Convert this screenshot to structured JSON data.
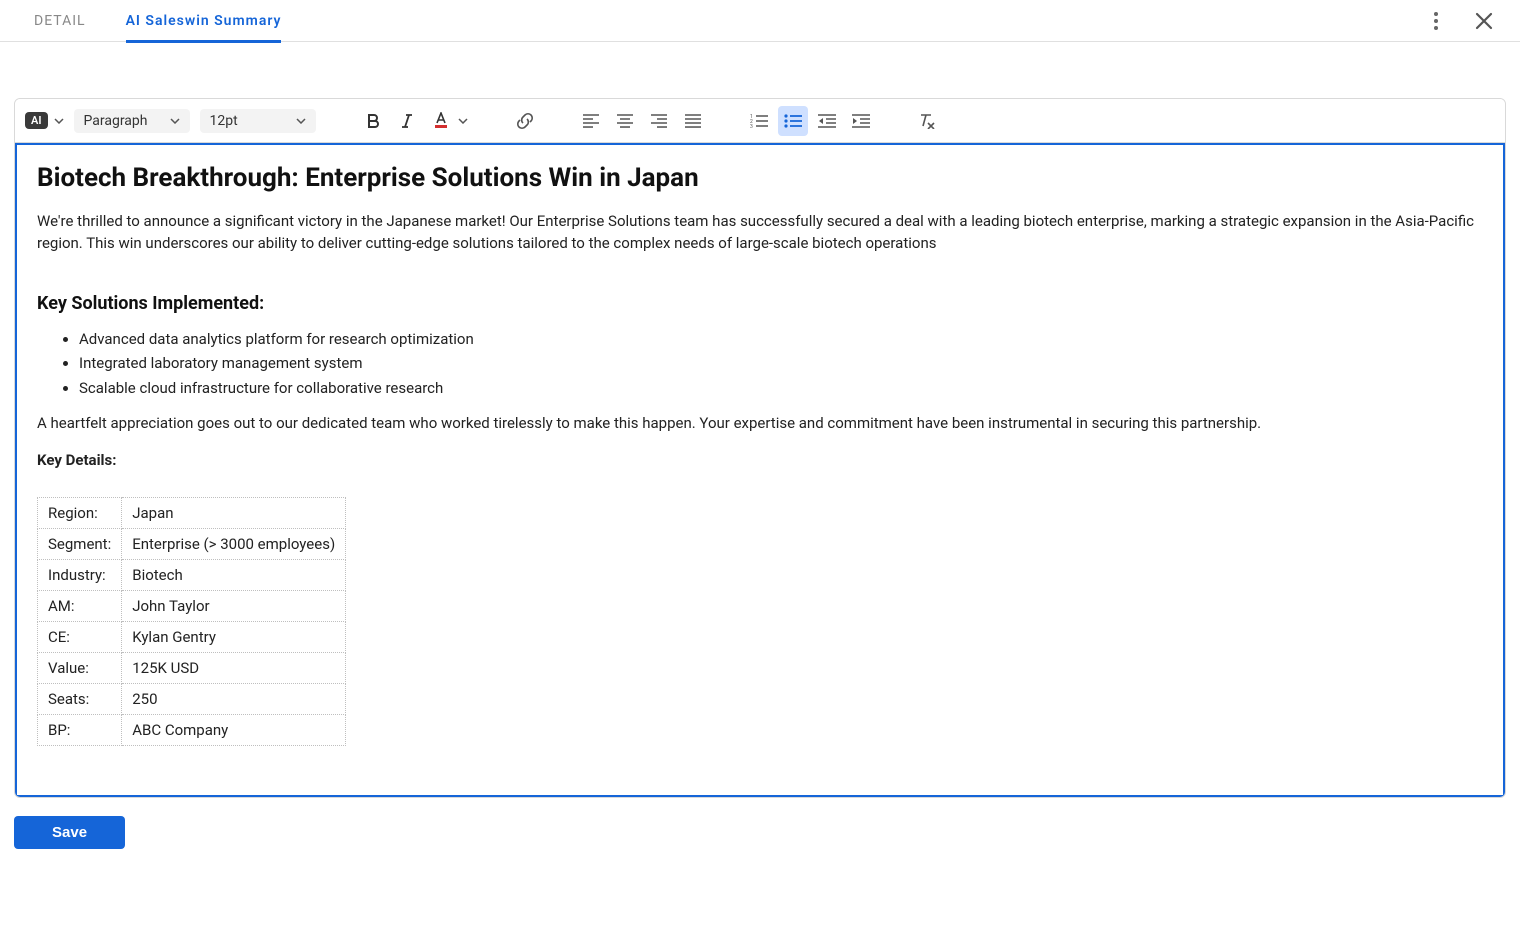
{
  "tabs": {
    "detail": "DETAIL",
    "saleswin": "AI Saleswin Summary"
  },
  "toolbar": {
    "ai_label": "AI",
    "block_select": "Paragraph",
    "size_select": "12pt"
  },
  "doc": {
    "title": "Biotech Breakthrough: Enterprise Solutions Win in Japan",
    "intro": "We're thrilled to announce a significant victory in the Japanese market! Our Enterprise Solutions team has successfully secured a deal with a leading biotech enterprise, marking a strategic expansion in the Asia-Pacific region. This win underscores our ability to deliver cutting-edge solutions tailored to the complex needs of large-scale biotech operations",
    "solutions_heading": "Key Solutions Implemented:",
    "solutions": [
      "Advanced data analytics platform for research optimization",
      "Integrated laboratory management system",
      "Scalable cloud infrastructure for collaborative research"
    ],
    "appreciation": "A heartfelt appreciation goes out to our dedicated team who worked tirelessly to make this happen. Your expertise and commitment have been instrumental in securing this partnership.",
    "details_label": "Key Details:",
    "details": [
      {
        "k": "Region:",
        "v": "Japan"
      },
      {
        "k": "Segment:",
        "v": "Enterprise (> 3000 employees)"
      },
      {
        "k": "Industry:",
        "v": "Biotech"
      },
      {
        "k": "AM:",
        "v": "John Taylor"
      },
      {
        "k": "CE:",
        "v": "Kylan Gentry"
      },
      {
        "k": "Value:",
        "v": "125K USD"
      },
      {
        "k": "Seats:",
        "v": "250"
      },
      {
        "k": "BP:",
        "v": "ABC Company"
      }
    ]
  },
  "actions": {
    "save": "Save"
  }
}
